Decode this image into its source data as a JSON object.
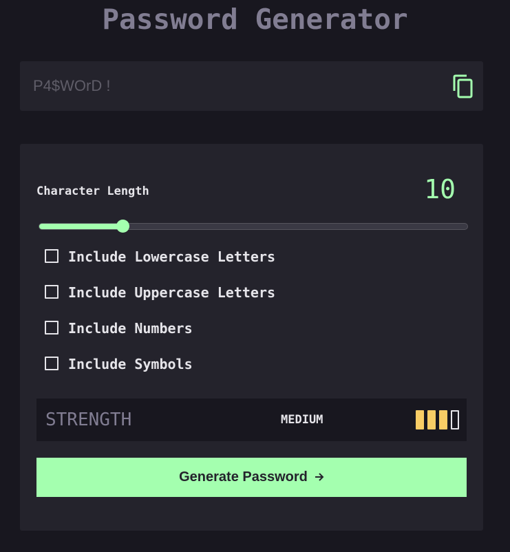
{
  "app": {
    "title": "Password Generator"
  },
  "password": {
    "value": "P4$WOrD !",
    "copy_icon": "copy-icon"
  },
  "length": {
    "label": "Character Length",
    "value": "10",
    "slider_fraction": 0.195
  },
  "options": [
    {
      "label": "Include Lowercase Letters",
      "checked": false
    },
    {
      "label": "Include Uppercase Letters",
      "checked": false
    },
    {
      "label": "Include Numbers",
      "checked": false
    },
    {
      "label": "Include Symbols",
      "checked": false
    }
  ],
  "strength": {
    "label": "STRENGTH",
    "value": "MEDIUM",
    "level": 3,
    "max_level": 4
  },
  "generate": {
    "label": "Generate Password",
    "icon": "arrow-right-icon"
  },
  "colors": {
    "accent": "#a4ffaf",
    "strength_medium": "#f8cd65",
    "background": "#18171f",
    "panel": "#24232c",
    "muted_text": "#817d92"
  }
}
